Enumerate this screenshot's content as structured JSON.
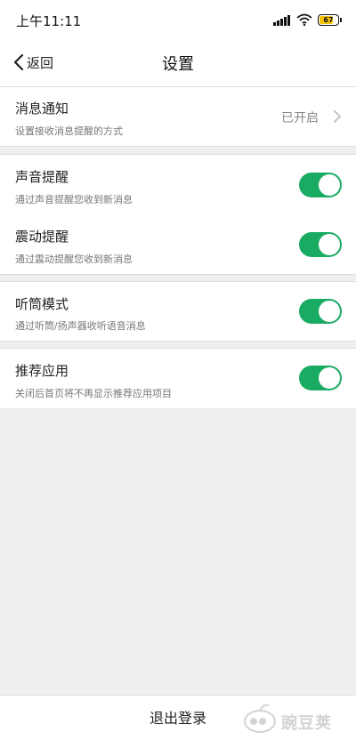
{
  "status_bar": {
    "time": "上午11:11",
    "battery_level": "67",
    "icons": [
      "signal-icon",
      "wifi-icon",
      "battery-icon"
    ]
  },
  "nav": {
    "back_label": "返回",
    "title": "设置"
  },
  "settings": {
    "notification": {
      "title": "消息通知",
      "subtitle": "设置接收消息提醒的方式",
      "value": "已开启"
    },
    "sound": {
      "title": "声音提醒",
      "subtitle": "通过声音提醒您收到新消息",
      "enabled": true
    },
    "vibration": {
      "title": "震动提醒",
      "subtitle": "通过震动提醒您收到新消息",
      "enabled": true
    },
    "earpiece": {
      "title": "听筒模式",
      "subtitle": "通过听筒/扬声器收听语音消息",
      "enabled": true
    },
    "recommend": {
      "title": "推荐应用",
      "subtitle": "关闭后首页将不再显示推荐应用项目",
      "enabled": true
    }
  },
  "footer": {
    "logout_label": "退出登录",
    "watermark_text": "豌豆荚"
  },
  "colors": {
    "toggle_on": "#1aab62",
    "background": "#efefef",
    "battery_fill": "#f5c400"
  }
}
